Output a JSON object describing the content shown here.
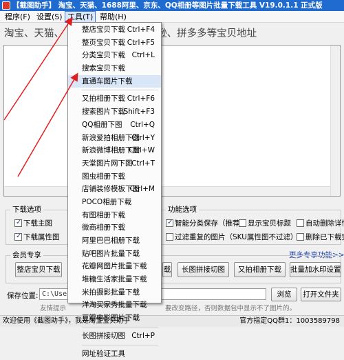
{
  "window": {
    "title": "【截图助手】 淘宝、天猫、1688阿里、京东、QQ相册等图片批量下载工具 V19.0.1.1 正式版"
  },
  "menubar": [
    {
      "label": "程序(F)"
    },
    {
      "label": "设置(S)"
    },
    {
      "label": "工具(T)"
    },
    {
      "label": "帮助(H)"
    }
  ],
  "banner": {
    "text": "淘宝、天猫、 速卖通、易贝、亚马逊、拼多多等宝贝地址"
  },
  "options": {
    "download_group_title": "下载选项",
    "cb_main": "下载主图",
    "cb_attr": "下载属性图",
    "func_group_title": "功能选项",
    "cb_smart": "智能分类保存（推荐）",
    "cb_show_title": "显示宝贝标题",
    "cb_auto_delete": "自动删除详情",
    "cb_filter": "过滤重复的图片（SKU属性图不过滤）",
    "cb_delete_downloaded": "删除已下载完",
    "more_link": "更多专享功能>>"
  },
  "member": {
    "group_title": "会员专享",
    "btn_shop": "整店宝贝下载",
    "btn_download": "载",
    "btn_stitch": "长图拼接切图",
    "btn_youpai": "又拍相册下载",
    "btn_watermark": "批量加水印设置"
  },
  "save": {
    "label": "保存位置:",
    "path": "C:\\Users\\",
    "browse": "浏览",
    "open_folder": "打开文件夹",
    "note_left": "友情提示",
    "note_right": "要改变路径，否则数据包中显示不了图片的。"
  },
  "status": {
    "left": "欢迎使用《截图助手》，我是淘宝宝贝助手",
    "right": "官方指定QQ群1：1003589798"
  },
  "tools_menu": {
    "items": [
      {
        "label": "整店宝贝下载",
        "shortcut": "Ctrl+F4"
      },
      {
        "label": "整页宝贝下载",
        "shortcut": "Ctrl+F5"
      },
      {
        "label": "分类宝贝下载",
        "shortcut": "Ctrl+L"
      },
      {
        "label": "搜索宝贝下载",
        "shortcut": ""
      },
      {
        "label": "直通车图片下载",
        "shortcut": ""
      },
      {
        "label": "又拍相册下载",
        "shortcut": "Ctrl+F6"
      },
      {
        "label": "搜索图片下载",
        "shortcut": "Shift+F3"
      },
      {
        "label": "QQ相册下图",
        "shortcut": "Ctrl+Q"
      },
      {
        "label": "新浪爱拍相册下图",
        "shortcut": "Ctrl+Y"
      },
      {
        "label": "新浪微博相册下图",
        "shortcut": "Ctrl+W"
      },
      {
        "label": "天堂图片网下图",
        "shortcut": "Ctrl+T"
      },
      {
        "label": "图虫相册下载",
        "shortcut": ""
      },
      {
        "label": "店铺装修模板下图",
        "shortcut": "Ctrl+M"
      },
      {
        "label": "POCO相册下载",
        "shortcut": ""
      },
      {
        "label": "有图相册下载",
        "shortcut": ""
      },
      {
        "label": "微商相册下载",
        "shortcut": ""
      },
      {
        "label": "阿里巴巴相册下载",
        "shortcut": ""
      },
      {
        "label": "贴吧图片批量下载",
        "shortcut": ""
      },
      {
        "label": "花瓣网图片批量下载",
        "shortcut": ""
      },
      {
        "label": "堆糖生活家批量下载",
        "shortcut": ""
      },
      {
        "label": "米拍摄影批量下载",
        "shortcut": ""
      },
      {
        "label": "洋淘买家秀批量下载",
        "shortcut": ""
      },
      {
        "label": "豆瓣电影图片下载",
        "shortcut": ""
      },
      {
        "label": "长图拼接切图",
        "shortcut": "Ctrl+P"
      },
      {
        "label": "网址验证工具",
        "shortcut": ""
      }
    ]
  },
  "colors": {
    "titlebar": "#1f6bd0",
    "arrow": "#e02020",
    "menu_highlight": "#d9e6f8"
  }
}
